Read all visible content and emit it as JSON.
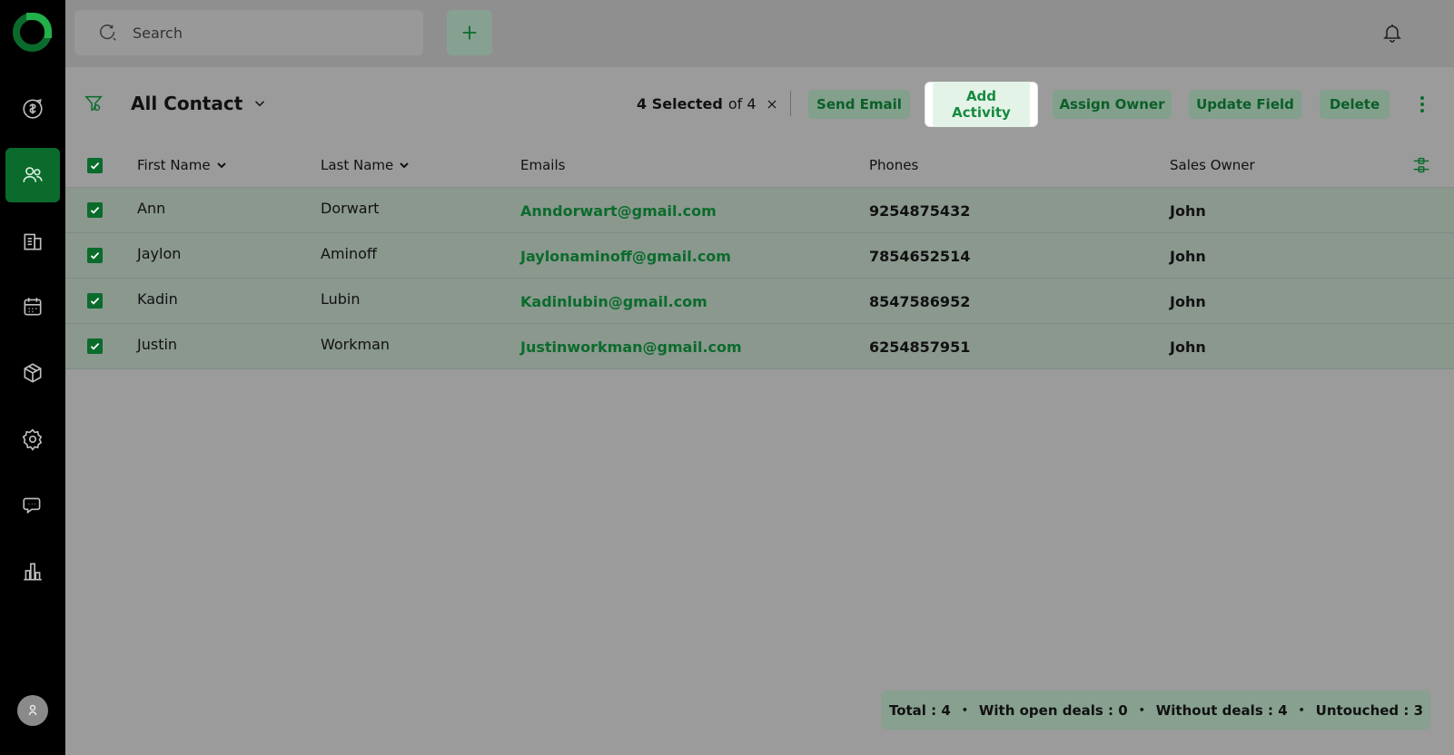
{
  "search": {
    "placeholder": "Search"
  },
  "toolbar": {
    "view_title": "All Contact",
    "selected_count": "4 Selected",
    "selected_of": "of 4",
    "actions": [
      "Send Email",
      "Add Activity",
      "Assign Owner",
      "Update Field",
      "Delete"
    ]
  },
  "table": {
    "columns": [
      "First Name",
      "Last Name",
      "Emails",
      "Phones",
      "Sales Owner"
    ],
    "rows": [
      {
        "first": "Ann",
        "last": "Dorwart",
        "email": "Anndorwart@gmail.com",
        "phone": "9254875432",
        "owner": "John"
      },
      {
        "first": "Jaylon",
        "last": "Aminoff",
        "email": "Jaylonaminoff@gmail.com",
        "phone": "7854652514",
        "owner": "John"
      },
      {
        "first": "Kadin",
        "last": "Lubin",
        "email": "Kadinlubin@gmail.com",
        "phone": "8547586952",
        "owner": "John"
      },
      {
        "first": "Justin",
        "last": "Workman",
        "email": "Justinworkman@gmail.com",
        "phone": "6254857951",
        "owner": "John"
      }
    ]
  },
  "stats": {
    "total": "Total : 4",
    "open_deals": "With open deals : 0",
    "without_deals": "Without deals : 4",
    "untouched": "Untouched : 3"
  },
  "colors": {
    "brand": "#0b6b2c",
    "accent_light": "#22b04b",
    "overlay": "#9b9b9b"
  },
  "icons": [
    "logo",
    "deals-icon",
    "contacts-icon",
    "companies-icon",
    "calendar-icon",
    "products-icon",
    "settings-icon",
    "chat-icon",
    "reports-icon",
    "user-icon",
    "search-icon",
    "plus-icon",
    "bell-icon",
    "filter-icon",
    "chevron-down-icon",
    "close-icon",
    "more-vertical-icon",
    "column-settings-icon",
    "checkbox-icon"
  ]
}
